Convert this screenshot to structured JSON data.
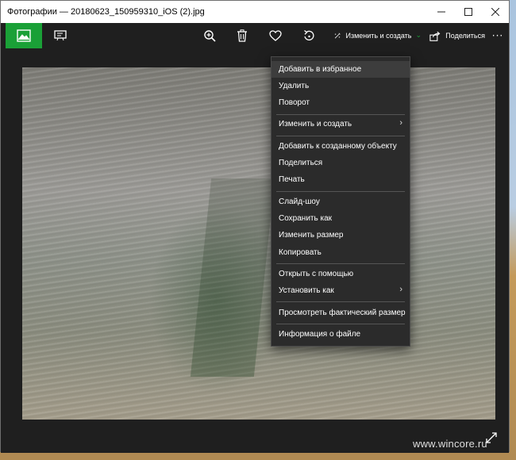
{
  "window": {
    "title": "Фотографии — 20180623_150959310_iOS (2).jpg"
  },
  "toolbar": {
    "edit_create_label": "Изменить и создать",
    "share_label": "Поделиться"
  },
  "context_menu": {
    "items": [
      {
        "label": "Добавить в избранное",
        "highlighted": true
      },
      {
        "label": "Удалить"
      },
      {
        "label": "Поворот"
      },
      {
        "label": "Изменить и создать",
        "submenu": true
      },
      {
        "label": "Добавить к созданному объекту"
      },
      {
        "label": "Поделиться"
      },
      {
        "label": "Печать"
      },
      {
        "label": "Слайд-шоу"
      },
      {
        "label": "Сохранить как"
      },
      {
        "label": "Изменить размер"
      },
      {
        "label": "Копировать"
      },
      {
        "label": "Открыть с помощью"
      },
      {
        "label": "Установить как",
        "submenu": true
      },
      {
        "label": "Просмотреть фактический размер"
      },
      {
        "label": "Информация о файле"
      }
    ]
  },
  "watermark": "www.wincore.ru",
  "colors": {
    "accent": "#1aa037",
    "toolbar_bg": "#1f1f1f",
    "menu_bg": "#2b2b2b"
  },
  "icons": {
    "home": "image-icon",
    "slideshow": "presentation-icon",
    "zoom": "zoom-in-icon",
    "delete": "trash-icon",
    "favorite": "heart-icon",
    "rotate": "rotate-icon",
    "edit": "edit-create-icon",
    "share": "share-icon",
    "more": "more-icon",
    "fullscreen": "fullscreen-icon"
  }
}
